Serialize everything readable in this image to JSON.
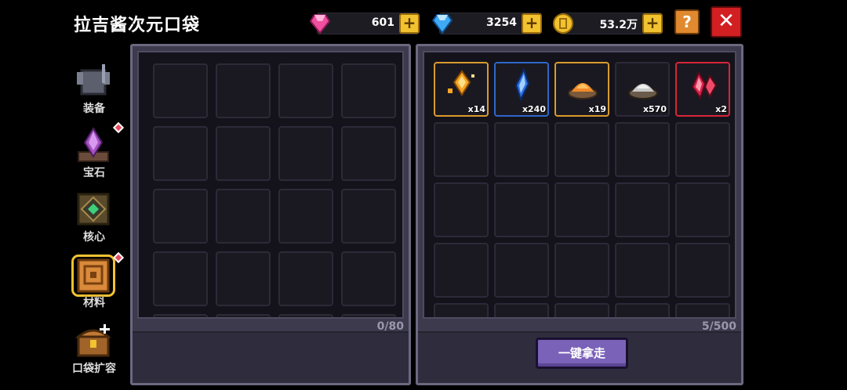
{
  "title": "拉吉酱次元口袋",
  "currencies": [
    {
      "name": "pink-gem",
      "amount": "601",
      "color": "#f04fa0"
    },
    {
      "name": "blue-diamond",
      "amount": "3254",
      "color": "#3fa9f5"
    },
    {
      "name": "gold-coin",
      "amount": "53.2万",
      "color": "#f2c230"
    }
  ],
  "help_label": "?",
  "close_label": "✕",
  "plus_label": "+",
  "sidebar": [
    {
      "label": "装备",
      "icon": "armor-icon",
      "badge": false
    },
    {
      "label": "宝石",
      "icon": "gem-icon",
      "badge": true
    },
    {
      "label": "核心",
      "icon": "core-icon",
      "badge": false
    },
    {
      "label": "材料",
      "icon": "material-book-icon",
      "badge": true,
      "active": true
    },
    {
      "label": "口袋扩容",
      "icon": "treasure-chest-icon",
      "badge": false
    }
  ],
  "left_panel": {
    "count": "0/80"
  },
  "right_panel": {
    "count": "5/500",
    "items": [
      {
        "name": "gold-shard",
        "qty": "x14",
        "rarity": "gold"
      },
      {
        "name": "blue-crystal",
        "qty": "x240",
        "rarity": "blue"
      },
      {
        "name": "orange-powder",
        "qty": "x19",
        "rarity": "gold"
      },
      {
        "name": "silver-dust",
        "qty": "x570",
        "rarity": "normal"
      },
      {
        "name": "red-crystal",
        "qty": "x2",
        "rarity": "red"
      }
    ],
    "take_all_label": "一键拿走"
  }
}
